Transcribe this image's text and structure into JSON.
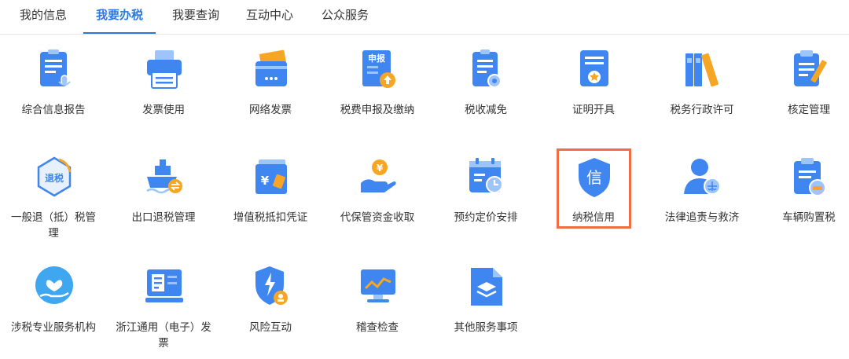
{
  "tabs": [
    {
      "label": "我的信息"
    },
    {
      "label": "我要办税"
    },
    {
      "label": "我要查询"
    },
    {
      "label": "互动中心"
    },
    {
      "label": "公众服务"
    }
  ],
  "active_tab": "我要办税",
  "items": [
    {
      "label": "综合信息报告",
      "icon": "document-microphone-icon"
    },
    {
      "label": "发票使用",
      "icon": "printer-icon"
    },
    {
      "label": "网络发票",
      "icon": "card-icon"
    },
    {
      "label": "税费申报及缴纳",
      "icon": "declaration-upload-icon",
      "icon_text": "申报"
    },
    {
      "label": "税收减免",
      "icon": "document-stamp-icon"
    },
    {
      "label": "证明开具",
      "icon": "certificate-star-icon"
    },
    {
      "label": "税务行政许可",
      "icon": "binders-icon"
    },
    {
      "label": "核定管理",
      "icon": "clipboard-pen-icon"
    },
    {
      "label": "一般退（抵）税管理",
      "icon": "tax-refund-icon",
      "icon_text": "退税"
    },
    {
      "label": "出口退税管理",
      "icon": "ship-export-icon"
    },
    {
      "label": "增值税抵扣凭证",
      "icon": "yuan-cards-icon",
      "icon_text": "¥"
    },
    {
      "label": "代保管资金收取",
      "icon": "hand-coin-icon",
      "icon_text": "¥"
    },
    {
      "label": "预约定价安排",
      "icon": "calendar-clock-icon"
    },
    {
      "label": "纳税信用",
      "icon": "credit-shield-icon",
      "icon_text": "信"
    },
    {
      "label": "法律追责与救济",
      "icon": "person-scales-icon"
    },
    {
      "label": "车辆购置税",
      "icon": "clipboard-car-icon"
    },
    {
      "label": "涉税专业服务机构",
      "icon": "hand-heart-icon"
    },
    {
      "label": "浙江通用（电子）发票",
      "icon": "terminal-receipt-icon"
    },
    {
      "label": "风险互动",
      "icon": "shield-lightning-icon"
    },
    {
      "label": "稽查检查",
      "icon": "monitor-chart-icon"
    },
    {
      "label": "其他服务事项",
      "icon": "document-layers-icon"
    }
  ],
  "highlighted_item": "纳税信用",
  "colors": {
    "accent": "#2b78d8",
    "highlight_border": "#ef6e46",
    "icon_blue": "#3f86f0",
    "icon_light": "#9ec5fa",
    "icon_orange": "#f6a623"
  }
}
